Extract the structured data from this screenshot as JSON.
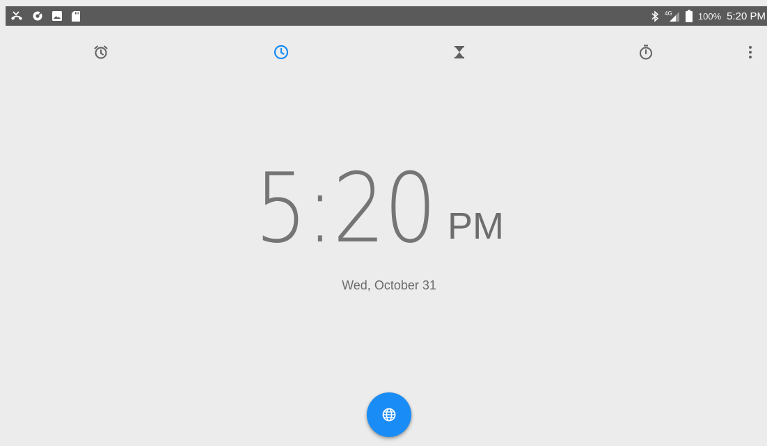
{
  "status_bar": {
    "icons_left": [
      "missed-call-icon",
      "sync-icon",
      "image-icon",
      "sd-card-icon"
    ],
    "icons_right": [
      "bluetooth-icon",
      "signal-4g-icon",
      "battery-icon"
    ],
    "network": "4G",
    "battery": "100%",
    "time": "5:20 PM"
  },
  "tabs": [
    {
      "name": "alarm",
      "icon": "alarm-icon",
      "active": false
    },
    {
      "name": "clock",
      "icon": "clock-icon",
      "active": true
    },
    {
      "name": "timer",
      "icon": "hourglass-icon",
      "active": false
    },
    {
      "name": "stopwatch",
      "icon": "stopwatch-icon",
      "active": false
    }
  ],
  "clock": {
    "time": "5:20",
    "ampm": "PM",
    "date": "Wed, October 31"
  },
  "fab": {
    "icon": "globe-icon"
  },
  "colors": {
    "accent": "#1a8cf5",
    "status_bar": "#5a5a5a",
    "background": "#ececec",
    "icon_inactive": "#616161",
    "time_text": "#757575"
  }
}
